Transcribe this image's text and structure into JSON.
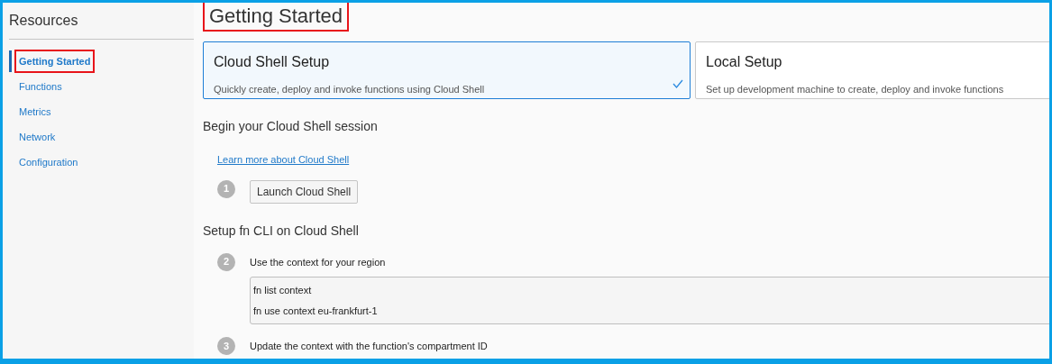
{
  "sidebar": {
    "title": "Resources",
    "items": [
      {
        "label": "Getting Started",
        "selected": true,
        "highlighted": true
      },
      {
        "label": "Functions",
        "selected": false,
        "highlighted": false
      },
      {
        "label": "Metrics",
        "selected": false,
        "highlighted": false
      },
      {
        "label": "Network",
        "selected": false,
        "highlighted": false
      },
      {
        "label": "Configuration",
        "selected": false,
        "highlighted": false
      }
    ]
  },
  "page_title": {
    "text": "Getting Started",
    "highlighted": true
  },
  "setup_cards": [
    {
      "title": "Cloud Shell Setup",
      "description": "Quickly create, deploy and invoke functions using Cloud Shell",
      "selected": true
    },
    {
      "title": "Local Setup",
      "description": "Set up development machine to create, deploy and invoke functions",
      "selected": false
    }
  ],
  "sections": [
    {
      "heading": "Begin your Cloud Shell session",
      "link": "Learn more about Cloud Shell",
      "steps": [
        {
          "number": "1",
          "kind": "button",
          "label": "Launch Cloud Shell"
        }
      ]
    },
    {
      "heading": "Setup fn CLI on Cloud Shell",
      "steps": [
        {
          "number": "2",
          "kind": "code",
          "label": "Use the context for your region",
          "code": [
            "fn list context",
            "fn use context eu-frankfurt-1"
          ]
        },
        {
          "number": "3",
          "kind": "text",
          "label": "Update the context with the function's compartment ID"
        }
      ]
    }
  ]
}
